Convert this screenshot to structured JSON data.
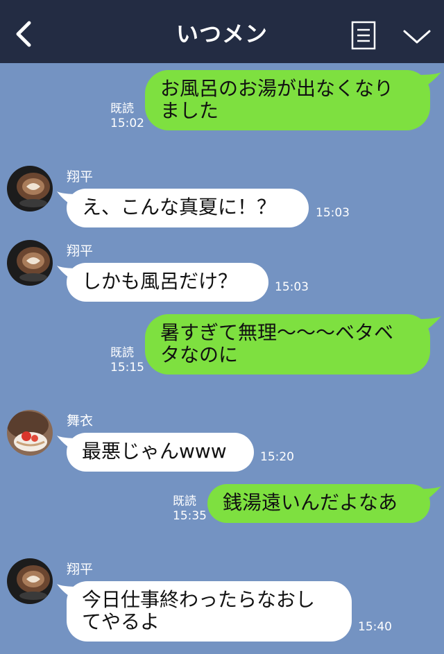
{
  "header": {
    "title": "いつメン",
    "back_icon": "chevron-left-icon",
    "menu_icon": "menu-icon",
    "expand_icon": "chevron-down-icon"
  },
  "colors": {
    "header_bg": "#232c43",
    "chat_bg": "#7493c2",
    "outgoing_bubble": "#7ee040",
    "incoming_bubble": "#ffffff"
  },
  "messages": [
    {
      "direction": "out",
      "text": "お風呂のお湯が出なくなり\nました",
      "read": "既読",
      "time": "15:02"
    },
    {
      "direction": "in",
      "sender": "翔平",
      "text": "え、こんな真夏に！？",
      "time": "15:03"
    },
    {
      "direction": "in",
      "sender": "翔平",
      "text": "しかも風呂だけ？",
      "time": "15:03"
    },
    {
      "direction": "out",
      "text": "暑すぎて無理〜〜〜ベタベ\nタなのに",
      "read": "既読",
      "time": "15:15"
    },
    {
      "direction": "in",
      "sender": "舞衣",
      "text": "最悪じゃんwww",
      "time": "15:20"
    },
    {
      "direction": "out",
      "text": "銭湯遠いんだよなあ",
      "read": "既読",
      "time": "15:35"
    },
    {
      "direction": "in",
      "sender": "翔平",
      "text": "今日仕事終わったらなおし\nてやるよ",
      "time": "15:40"
    }
  ]
}
